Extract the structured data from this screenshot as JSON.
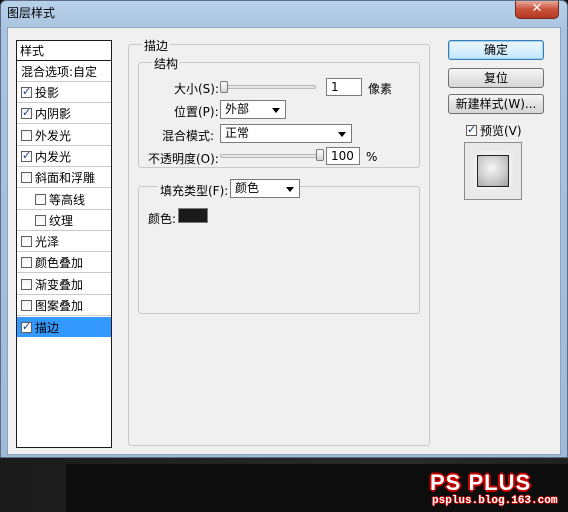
{
  "window": {
    "title": "图层样式",
    "close_label": "✕"
  },
  "list": {
    "header": "样式",
    "blend_options": "混合选项:自定",
    "items": [
      {
        "label": "投影",
        "checked": true
      },
      {
        "label": "内阴影",
        "checked": true
      },
      {
        "label": "外发光",
        "checked": false
      },
      {
        "label": "内发光",
        "checked": true
      },
      {
        "label": "斜面和浮雕",
        "checked": false
      },
      {
        "label": "等高线",
        "checked": false
      },
      {
        "label": "纹理",
        "checked": false
      },
      {
        "label": "光泽",
        "checked": false
      },
      {
        "label": "颜色叠加",
        "checked": false
      },
      {
        "label": "渐变叠加",
        "checked": false
      },
      {
        "label": "图案叠加",
        "checked": false
      },
      {
        "label": "描边",
        "checked": true
      }
    ]
  },
  "stroke": {
    "group_title": "描边",
    "structure_title": "结构",
    "size_label": "大小(S):",
    "size_value": "1",
    "size_unit": "像素",
    "position_label": "位置(P):",
    "position_value": "外部",
    "blend_label": "混合模式:",
    "blend_value": "正常",
    "opacity_label": "不透明度(O):",
    "opacity_value": "100",
    "opacity_unit": "%",
    "size_slider_fraction": 0.0,
    "opacity_slider_fraction": 1.0,
    "fill_type_label": "填充类型(F):",
    "fill_type_value": "颜色",
    "color_label": "颜色:",
    "color_value": "#1a1a1a"
  },
  "buttons": {
    "ok": "确定",
    "reset": "复位",
    "new_style": "新建样式(W)...",
    "preview": "预览(V)",
    "preview_checked": true
  },
  "watermark": {
    "main": "PS PLUS",
    "sub": "psplus.blog.163.com"
  }
}
